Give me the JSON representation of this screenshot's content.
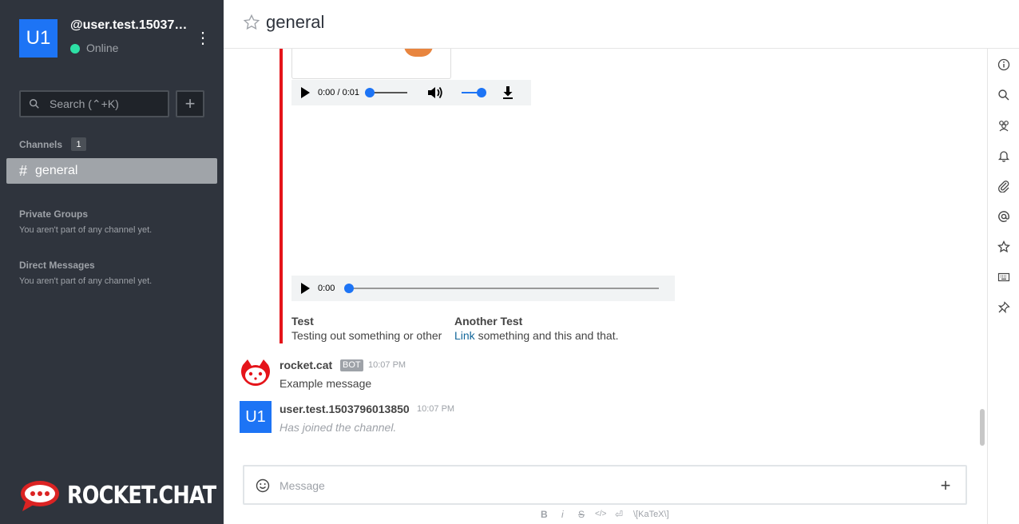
{
  "user": {
    "avatar_initials": "U1",
    "name": "@user.test.15037…",
    "status": "Online"
  },
  "sidebar": {
    "search_placeholder": "Search (⌃+K)",
    "add_label": "+",
    "channels_title": "Channels",
    "channels_count": "1",
    "channel_hash": "#",
    "channel_name": "general",
    "private_groups_title": "Private Groups",
    "private_groups_empty": "You aren't part of any channel yet.",
    "direct_messages_title": "Direct Messages",
    "direct_messages_empty": "You aren't part of any channel yet.",
    "logo_text": "ROCKET.CHAT"
  },
  "header": {
    "room_title": "general"
  },
  "toolbar": {
    "icons": [
      "info-icon",
      "search-icon",
      "members-icon",
      "bell-icon",
      "paperclip-icon",
      "at-icon",
      "star-icon",
      "keyboard-icon",
      "pin-icon"
    ]
  },
  "attachment": {
    "audio1_time": "0:00 / 0:01",
    "audio2_time": "0:00",
    "audio1_seek_progress": 0,
    "audio1_volume": 1,
    "audio2_seek_progress": 0,
    "field1_title": "Test",
    "field1_value": "Testing out something or other",
    "field2_title": "Another Test",
    "field2_link": "Link",
    "field2_value": " something and this and that."
  },
  "messages": [
    {
      "user": "rocket.cat",
      "badge": "BOT",
      "time": "10:07 PM",
      "text": "Example message"
    },
    {
      "avatar_initials": "U1",
      "user": "user.test.1503796013850",
      "time": "10:07 PM",
      "text": "Has joined the channel."
    }
  ],
  "composer": {
    "placeholder": "Message",
    "add_label": "+"
  },
  "formatting": {
    "bold": "B",
    "italic": "i",
    "strike": "S",
    "code": "</>",
    "newline": "⏎",
    "katex": "\\[KaTeX\\]"
  },
  "colors": {
    "sidebar_bg": "#2f343d",
    "accent_blue": "#1d74f5",
    "online_green": "#2de0a5",
    "attachment_bar_red": "#e5141a",
    "link_blue": "#13679a"
  }
}
